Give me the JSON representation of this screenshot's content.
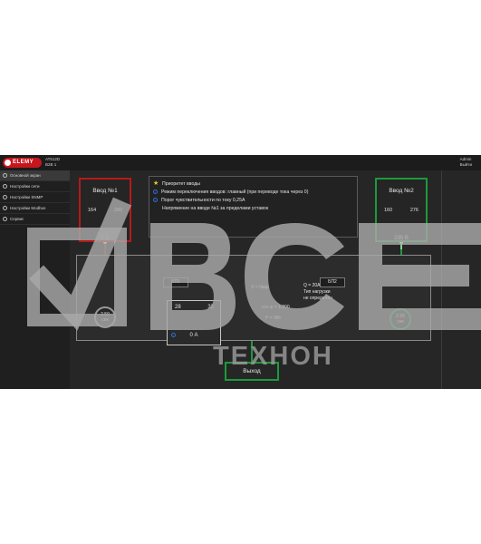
{
  "header": {
    "logo_text": "ELEMY",
    "model_line1": "AT512D",
    "model_line2": "B2B 1",
    "user_line1": "Admin",
    "user_line2": "Выйти"
  },
  "sidebar": {
    "items": [
      {
        "label": "Основной экран",
        "icon": "home-icon"
      },
      {
        "label": "Настройки сети",
        "icon": "network-icon"
      },
      {
        "label": "Настройки SNMP",
        "icon": "snmp-icon"
      },
      {
        "label": "Настройки Modbus",
        "icon": "modbus-icon"
      },
      {
        "label": "Сервис",
        "icon": "service-icon"
      }
    ]
  },
  "messages": [
    {
      "icon": "star-icon",
      "text": "Приоритет вводы"
    },
    {
      "icon": "info-icon",
      "text": "Режим переключения вводов: главный (при переводе тока через 0)"
    },
    {
      "icon": "info-icon",
      "text": "Порог чувствительности по току 0,25А"
    },
    {
      "icon": "none",
      "text": "Напряжение на вводе №1 за пределами уставок"
    }
  ],
  "input1": {
    "title": "Ввод №1",
    "min": "164",
    "max": "280",
    "value": "0 В",
    "level": 0,
    "color": "#b51a1a"
  },
  "input2": {
    "title": "Ввод №2",
    "min": "160",
    "max": "276",
    "value": "235 В",
    "level": 0.6,
    "color": "#1c9a3a"
  },
  "bus": {
    "left": "БП1",
    "right": "БП2"
  },
  "timer1": {
    "value": "2.50",
    "unit": "сек"
  },
  "timer2": {
    "value": "2.25",
    "unit": "сек"
  },
  "current": {
    "min": "28",
    "max": "32",
    "value": "0 А",
    "level": 0.35
  },
  "metrics": {
    "s": "S = 0вар",
    "q": "Q = 20А",
    "cos": "cos φ = 1.000",
    "p": "P = 0Вт",
    "load_type_1": "Тип нагрузки",
    "load_type_2": "не определён"
  },
  "output_label": "Выход",
  "watermark": {
    "text": "ТЕХНОН",
    "big": "ВСЕ"
  },
  "colors": {
    "red": "#b51a1a",
    "green": "#1c9a3a",
    "background": "#2b2b2b"
  }
}
